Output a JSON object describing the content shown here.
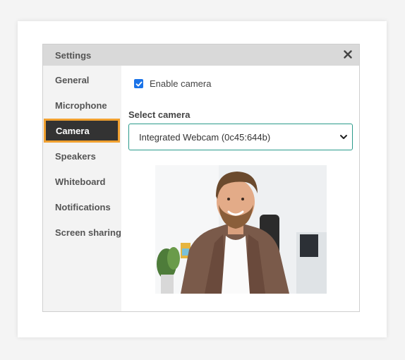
{
  "dialog": {
    "title": "Settings"
  },
  "sidebar": {
    "items": [
      {
        "label": "General"
      },
      {
        "label": "Microphone"
      },
      {
        "label": "Camera"
      },
      {
        "label": "Speakers"
      },
      {
        "label": "Whiteboard"
      },
      {
        "label": "Notifications"
      },
      {
        "label": "Screen sharing"
      }
    ]
  },
  "camera": {
    "enable_label": "Enable camera",
    "enabled": true,
    "select_label": "Select camera",
    "selected_device": "Integrated Webcam (0c45:644b)"
  },
  "colors": {
    "accent": "#f0a030",
    "active_bg": "#333333",
    "checkbox": "#1a73e8",
    "select_border": "#2a9a8b"
  }
}
